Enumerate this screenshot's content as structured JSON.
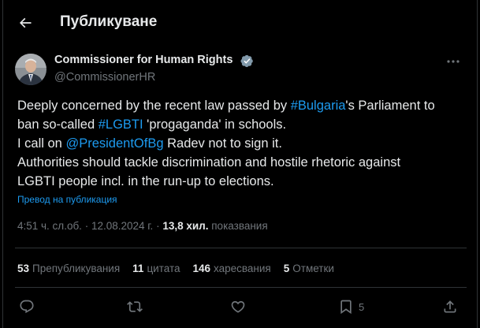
{
  "header": {
    "title": "Публикуване"
  },
  "tweet": {
    "author_name": "Commissioner for Human Rights",
    "author_handle": "@CommissionerHR",
    "text": {
      "l1_a": "Deeply concerned by the recent law passed by ",
      "l1_link": "#Bulgaria",
      "l1_b": "'s Parliament to",
      "l2_a": "ban so-called ",
      "l2_link": "#LGBTI",
      "l2_b": " 'progaganda' in schools.",
      "l3_a": "I call on ",
      "l3_link": "@PresidentOfBg",
      "l3_b": " Radev not to sign it.",
      "l4": "Authorities should tackle discrimination and hostile rhetoric against",
      "l5": "LGBTI people incl. in the run-up to elections."
    },
    "translate_label": "Превод на публикация",
    "time": "4:51 ч. сл.об.",
    "date": "12.08.2024 г.",
    "views_count": "13,8 хил.",
    "views_label": "показвания"
  },
  "stats": {
    "reposts_count": "53",
    "reposts_label": "Препубликувания",
    "quotes_count": "11",
    "quotes_label": "цитата",
    "likes_count": "146",
    "likes_label": "харесвания",
    "bookmarks_count": "5",
    "bookmarks_label": "Отметки"
  },
  "actions": {
    "bookmark_count": "5"
  },
  "icons": {
    "back": "arrow-left-icon",
    "verified": "verified-badge-icon",
    "more": "more-dots-icon",
    "reply": "reply-icon",
    "repost": "repost-icon",
    "like": "heart-icon",
    "bookmark": "bookmark-icon",
    "share": "share-icon"
  },
  "colors": {
    "background": "#000000",
    "text": "#e7e9ea",
    "secondary": "#71767b",
    "accent": "#1d9bf0",
    "divider": "#2f3336"
  }
}
